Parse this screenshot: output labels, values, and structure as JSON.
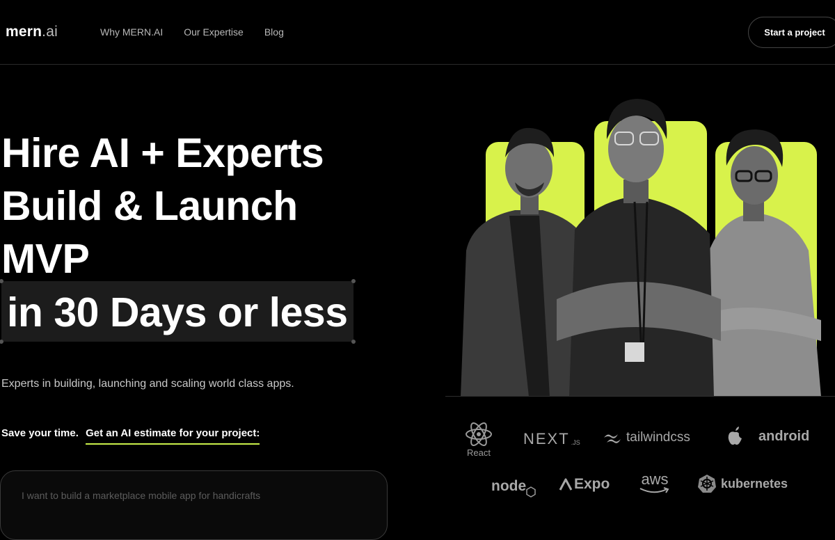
{
  "header": {
    "logo_main": "mern",
    "logo_dot": ".ai",
    "nav": [
      "Why MERN.AI",
      "Our Expertise",
      "Blog"
    ],
    "cta": "Start a project"
  },
  "hero": {
    "line1": "Hire AI + Experts",
    "line2": "Build & Launch",
    "line3": "MVP",
    "highlight": "in 30 Days or less",
    "subtitle": "Experts in building, launching and scaling world class apps.",
    "save_text": "Save your time.",
    "estimate_link": "Get an AI estimate for your project:",
    "prompt_placeholder": "I want to build a marketplace mobile app for handicrafts"
  },
  "tech": {
    "react": "React",
    "next": "NEXT",
    "next_suffix": ".JS",
    "tailwind": "tailwindcss",
    "android": "android",
    "node": "node",
    "expo": "Expo",
    "aws": "aws",
    "kubernetes": "kubernetes"
  },
  "colors": {
    "accent": "#d8f24b",
    "background": "#000000"
  }
}
